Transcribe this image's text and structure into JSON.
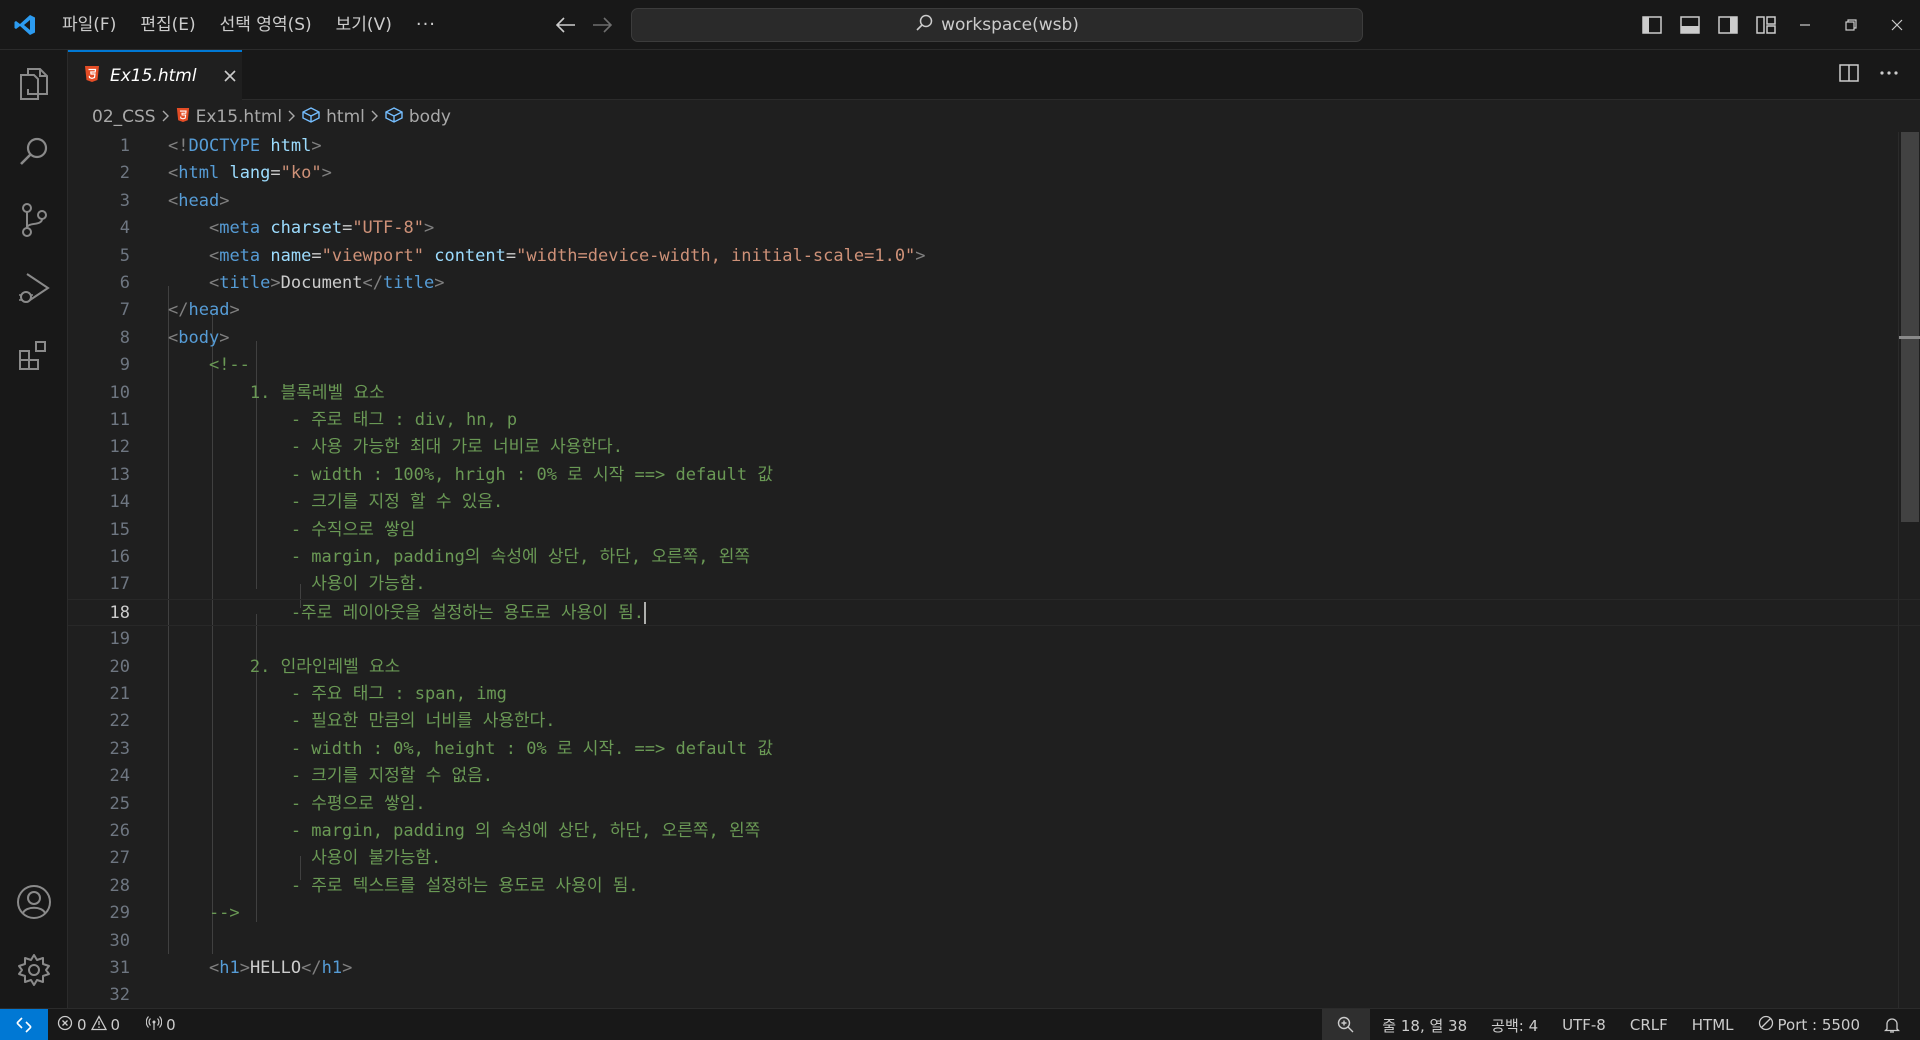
{
  "titlebar": {
    "menu": [
      "파일(F)",
      "편집(E)",
      "선택 영역(S)",
      "보기(V)"
    ],
    "more": "···",
    "search_text": "workspace(wsb)"
  },
  "tab": {
    "label": "Ex15.html"
  },
  "breadcrumb": [
    "02_CSS",
    "Ex15.html",
    "html",
    "body"
  ],
  "editor": {
    "active_line": 18,
    "lines": [
      {
        "n": "1",
        "tokens": [
          [
            "br",
            "<!"
          ],
          [
            "tag",
            "DOCTYPE"
          ],
          [
            "txt",
            " "
          ],
          [
            "attr",
            "html"
          ],
          [
            "br",
            ">"
          ]
        ]
      },
      {
        "n": "2",
        "tokens": [
          [
            "br",
            "<"
          ],
          [
            "tag",
            "html"
          ],
          [
            "txt",
            " "
          ],
          [
            "attr",
            "lang"
          ],
          [
            "txt",
            "="
          ],
          [
            "str",
            "\"ko\""
          ],
          [
            "br",
            ">"
          ]
        ]
      },
      {
        "n": "3",
        "tokens": [
          [
            "br",
            "<"
          ],
          [
            "tag",
            "head"
          ],
          [
            "br",
            ">"
          ]
        ]
      },
      {
        "n": "4",
        "tokens": [
          [
            "txt",
            "    "
          ],
          [
            "br",
            "<"
          ],
          [
            "tag",
            "meta"
          ],
          [
            "txt",
            " "
          ],
          [
            "attr",
            "charset"
          ],
          [
            "txt",
            "="
          ],
          [
            "str",
            "\"UTF-8\""
          ],
          [
            "br",
            ">"
          ]
        ]
      },
      {
        "n": "5",
        "tokens": [
          [
            "txt",
            "    "
          ],
          [
            "br",
            "<"
          ],
          [
            "tag",
            "meta"
          ],
          [
            "txt",
            " "
          ],
          [
            "attr",
            "name"
          ],
          [
            "txt",
            "="
          ],
          [
            "str",
            "\"viewport\""
          ],
          [
            "txt",
            " "
          ],
          [
            "attr",
            "content"
          ],
          [
            "txt",
            "="
          ],
          [
            "str",
            "\"width=device-width, initial-scale=1.0\""
          ],
          [
            "br",
            ">"
          ]
        ]
      },
      {
        "n": "6",
        "tokens": [
          [
            "txt",
            "    "
          ],
          [
            "br",
            "<"
          ],
          [
            "tag",
            "title"
          ],
          [
            "br",
            ">"
          ],
          [
            "txt",
            "Document"
          ],
          [
            "br",
            "</"
          ],
          [
            "tag",
            "title"
          ],
          [
            "br",
            ">"
          ]
        ]
      },
      {
        "n": "7",
        "tokens": [
          [
            "br",
            "</"
          ],
          [
            "tag",
            "head"
          ],
          [
            "br",
            ">"
          ]
        ]
      },
      {
        "n": "8",
        "tokens": [
          [
            "br",
            "<"
          ],
          [
            "tag",
            "body"
          ],
          [
            "br",
            ">"
          ]
        ]
      },
      {
        "n": "9",
        "tokens": [
          [
            "txt",
            "    "
          ],
          [
            "com",
            "<!--"
          ]
        ]
      },
      {
        "n": "10",
        "tokens": [
          [
            "com",
            "        1. 블록레벨 요소"
          ]
        ]
      },
      {
        "n": "11",
        "tokens": [
          [
            "com",
            "            - 주로 태그 : div, hn, p"
          ]
        ]
      },
      {
        "n": "12",
        "tokens": [
          [
            "com",
            "            - 사용 가능한 최대 가로 너비로 사용한다."
          ]
        ]
      },
      {
        "n": "13",
        "tokens": [
          [
            "com",
            "            - width : 100%, hrigh : 0% 로 시작 ==> default 값"
          ]
        ]
      },
      {
        "n": "14",
        "tokens": [
          [
            "com",
            "            - 크기를 지정 할 수 있음."
          ]
        ]
      },
      {
        "n": "15",
        "tokens": [
          [
            "com",
            "            - 수직으로 쌓임"
          ]
        ]
      },
      {
        "n": "16",
        "tokens": [
          [
            "com",
            "            - margin, padding의 속성에 상단, 하단, 오른쪽, 왼쪽"
          ]
        ]
      },
      {
        "n": "17",
        "tokens": [
          [
            "com",
            "              사용이 가능함."
          ]
        ]
      },
      {
        "n": "18",
        "tokens": [
          [
            "com",
            "            -주로 레이아웃을 설정하는 용도로 사용이 됨."
          ]
        ]
      },
      {
        "n": "19",
        "tokens": []
      },
      {
        "n": "20",
        "tokens": [
          [
            "com",
            "        2. 인라인레벨 요소"
          ]
        ]
      },
      {
        "n": "21",
        "tokens": [
          [
            "com",
            "            - 주요 태그 : span, img"
          ]
        ]
      },
      {
        "n": "22",
        "tokens": [
          [
            "com",
            "            - 필요한 만큼의 너비를 사용한다."
          ]
        ]
      },
      {
        "n": "23",
        "tokens": [
          [
            "com",
            "            - width : 0%, height : 0% 로 시작. ==> default 값"
          ]
        ]
      },
      {
        "n": "24",
        "tokens": [
          [
            "com",
            "            - 크기를 지정할 수 없음."
          ]
        ]
      },
      {
        "n": "25",
        "tokens": [
          [
            "com",
            "            - 수평으로 쌓임."
          ]
        ]
      },
      {
        "n": "26",
        "tokens": [
          [
            "com",
            "            - margin, padding 의 속성에 상단, 하단, 오른쪽, 왼쪽"
          ]
        ]
      },
      {
        "n": "27",
        "tokens": [
          [
            "com",
            "              사용이 불가능함."
          ]
        ]
      },
      {
        "n": "28",
        "tokens": [
          [
            "com",
            "            - 주로 텍스트를 설정하는 용도로 사용이 됨."
          ]
        ]
      },
      {
        "n": "29",
        "tokens": [
          [
            "com",
            "    -->"
          ]
        ]
      },
      {
        "n": "30",
        "tokens": []
      },
      {
        "n": "31",
        "tokens": [
          [
            "txt",
            "    "
          ],
          [
            "br",
            "<"
          ],
          [
            "tag",
            "h1"
          ],
          [
            "br",
            ">"
          ],
          [
            "txt",
            "HELLO"
          ],
          [
            "br",
            "</"
          ],
          [
            "tag",
            "h1"
          ],
          [
            "br",
            ">"
          ]
        ]
      },
      {
        "n": "32",
        "tokens": []
      }
    ]
  },
  "statusbar": {
    "errors": "0",
    "warnings": "0",
    "ports": "0",
    "position": "줄 18, 열 38",
    "spaces": "공백: 4",
    "encoding": "UTF-8",
    "eol": "CRLF",
    "language": "HTML",
    "port": "Port : 5500"
  },
  "colors": {
    "accent": "#0078d4",
    "comment": "#6a9955",
    "tag": "#569cd6",
    "attribute": "#9cdcfe",
    "string": "#ce9178"
  }
}
